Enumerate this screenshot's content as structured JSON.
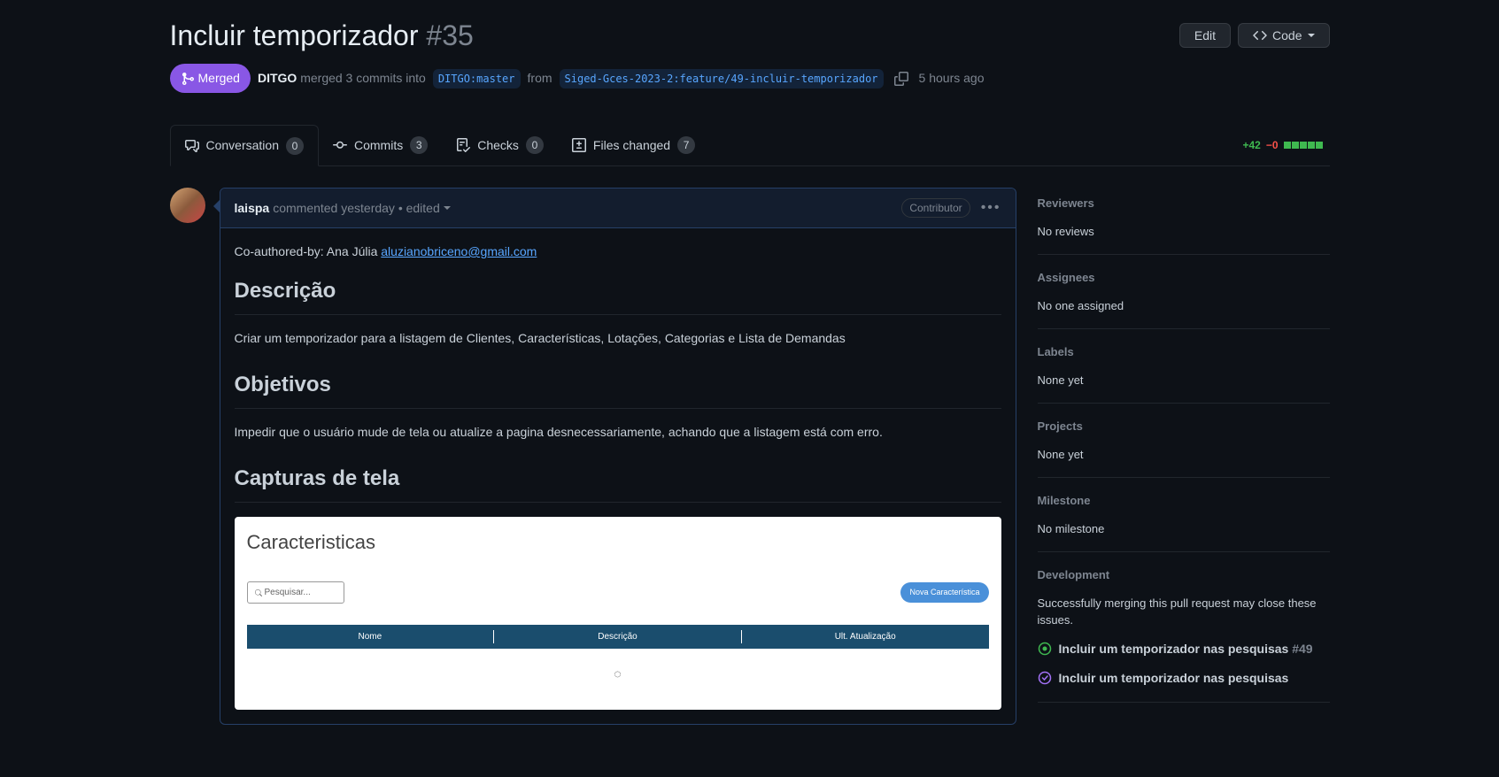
{
  "header": {
    "title": "Incluir temporizador",
    "number": "#35",
    "edit_label": "Edit",
    "code_label": "Code"
  },
  "state": {
    "label": "Merged",
    "author": "DITGO",
    "merged_text": "merged 3 commits into",
    "base_branch": "DITGO:master",
    "from_text": "from",
    "head_branch": "Siged-Gces-2023-2:feature/49-incluir-temporizador",
    "time": "5 hours ago"
  },
  "tabs": {
    "conversation": {
      "label": "Conversation",
      "count": "0"
    },
    "commits": {
      "label": "Commits",
      "count": "3"
    },
    "checks": {
      "label": "Checks",
      "count": "0"
    },
    "files": {
      "label": "Files changed",
      "count": "7"
    }
  },
  "diff": {
    "additions": "+42",
    "deletions": "−0"
  },
  "comment": {
    "author": "laispa",
    "header_text": "commented yesterday • edited",
    "badge": "Contributor",
    "coauthor_prefix": "Co-authored-by: Ana Júlia ",
    "coauthor_email": "aluzianobriceno@gmail.com",
    "h_desc": "Descrição",
    "desc_body": "Criar um temporizador para a listagem de Clientes, Características, Lotações, Categorias e Lista de Demandas",
    "h_obj": "Objetivos",
    "obj_body": "Impedir que o usuário mude de tela ou atualize a pagina desnecessariamente, achando que a listagem está com erro.",
    "h_screens": "Capturas de tela"
  },
  "screenshot": {
    "title": "Caracteristicas",
    "search_placeholder": "Pesquisar...",
    "new_btn": "Nova Característica",
    "col_name": "Nome",
    "col_desc": "Descrição",
    "col_updated": "Ult. Atualização"
  },
  "sidebar": {
    "reviewers": {
      "title": "Reviewers",
      "value": "No reviews"
    },
    "assignees": {
      "title": "Assignees",
      "value": "No one assigned"
    },
    "labels": {
      "title": "Labels",
      "value": "None yet"
    },
    "projects": {
      "title": "Projects",
      "value": "None yet"
    },
    "milestone": {
      "title": "Milestone",
      "value": "No milestone"
    },
    "development": {
      "title": "Development",
      "desc": "Successfully merging this pull request may close these issues.",
      "issues": [
        {
          "title": "Incluir um temporizador nas pesquisas",
          "num": "#49",
          "state": "open"
        },
        {
          "title": "Incluir um temporizador nas pesquisas",
          "num": "",
          "state": "closed"
        }
      ]
    }
  }
}
